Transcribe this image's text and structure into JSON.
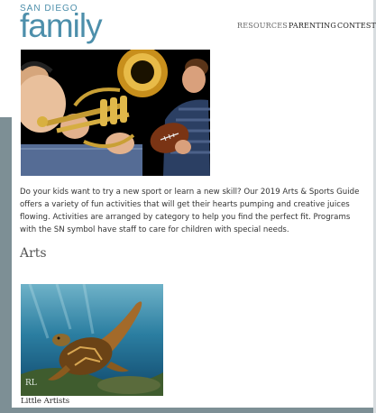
{
  "brand": {
    "small": "SAN DIEGO",
    "big": "family",
    "color": "#4d8fab"
  },
  "nav": {
    "items": [
      "RESOURCES",
      "PARENTING",
      "CONTESTS"
    ]
  },
  "intro": "Do your kids want to try a new sport or learn a new skill? Our 2019 Arts & Sports Guide offers a variety of fun activities that will get their hearts pumping and creative juices flowing. Activities are arranged by category to help you find the perfect fit. Programs with the SN symbol have staff to care for children with special needs.",
  "section": {
    "title": "Arts"
  },
  "card": {
    "caption": "Little Artists",
    "signature": "RL"
  }
}
